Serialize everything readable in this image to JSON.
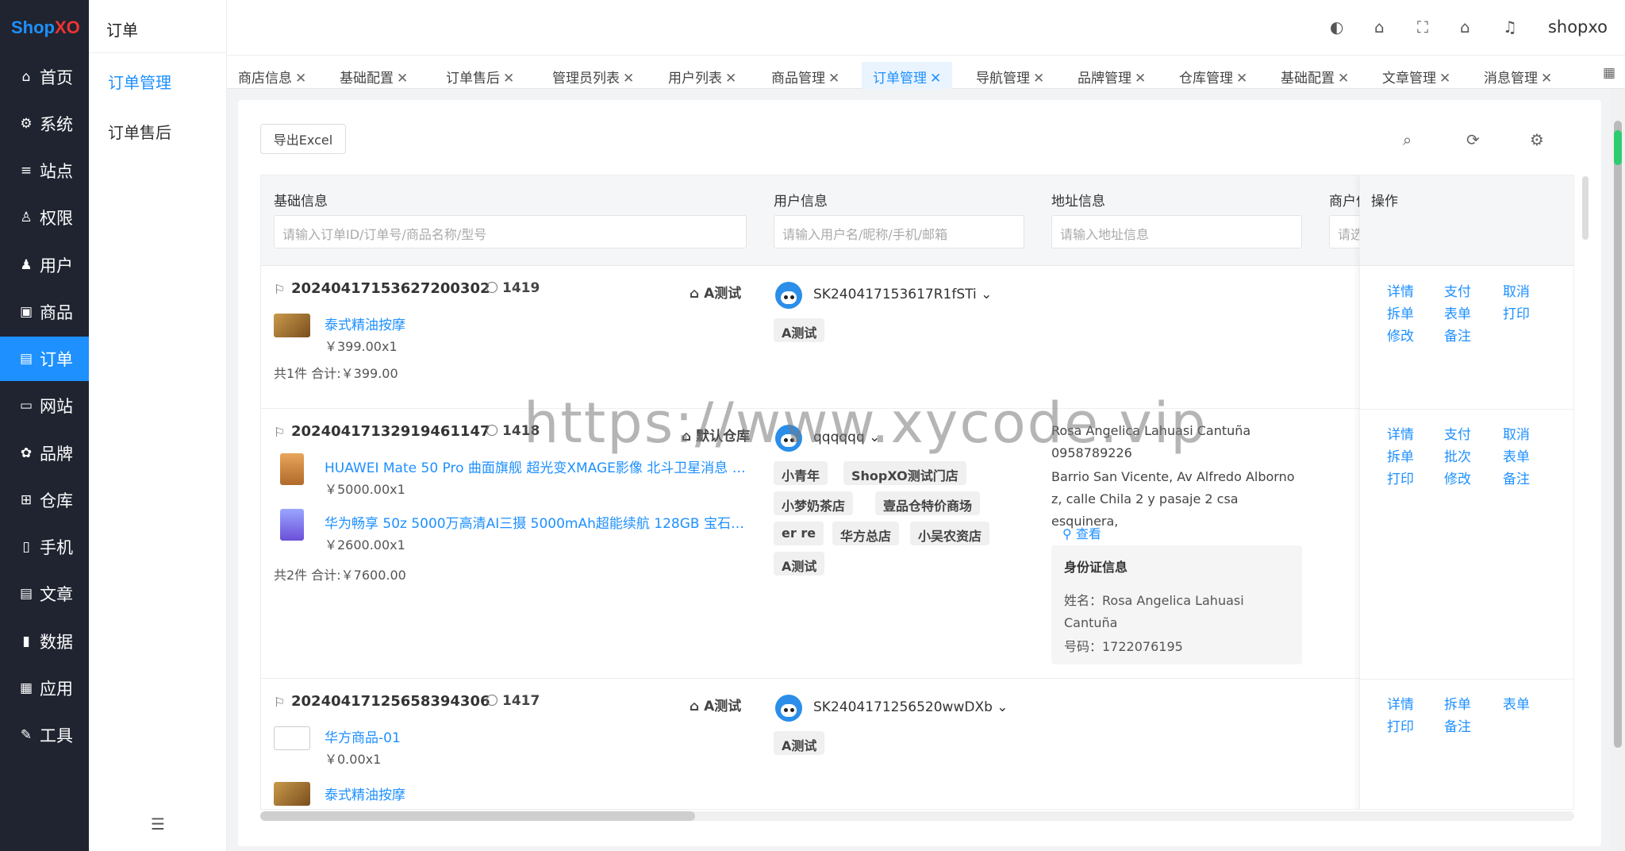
{
  "brand": {
    "shop": "Shop",
    "xo": "XO"
  },
  "nav": [
    {
      "label": "首页",
      "icon": "home-icon"
    },
    {
      "label": "系统",
      "icon": "gear-icon"
    },
    {
      "label": "站点",
      "icon": "sliders-icon"
    },
    {
      "label": "权限",
      "icon": "user-lock-icon"
    },
    {
      "label": "用户",
      "icon": "user-icon"
    },
    {
      "label": "商品",
      "icon": "box-icon"
    },
    {
      "label": "订单",
      "icon": "order-icon"
    },
    {
      "label": "网站",
      "icon": "monitor-icon"
    },
    {
      "label": "品牌",
      "icon": "brand-icon"
    },
    {
      "label": "仓库",
      "icon": "warehouse-icon"
    },
    {
      "label": "手机",
      "icon": "phone-icon"
    },
    {
      "label": "文章",
      "icon": "article-icon"
    },
    {
      "label": "数据",
      "icon": "chart-icon"
    },
    {
      "label": "应用",
      "icon": "apps-icon"
    },
    {
      "label": "工具",
      "icon": "wrench-icon"
    }
  ],
  "subnav": {
    "title": "订单",
    "items": [
      "订单管理",
      "订单售后"
    ]
  },
  "header": {
    "user": "shopxo"
  },
  "tabs": [
    "商店信息",
    "基础配置",
    "订单售后",
    "管理员列表",
    "用户列表",
    "商品管理",
    "订单管理",
    "导航管理",
    "品牌管理",
    "仓库管理",
    "基础配置",
    "文章管理",
    "消息管理"
  ],
  "toolbar": {
    "export": "导出Excel"
  },
  "table": {
    "headers": {
      "basic": "基础信息",
      "user": "用户信息",
      "address": "地址信息",
      "merchant": "商户信",
      "ops": "操作"
    },
    "filters": {
      "basic": "请输入订单ID/订单号/商品名称/型号",
      "user": "请输入用户名/昵称/手机/邮箱",
      "address": "请输入地址信息",
      "merchant": "请选"
    },
    "rows": [
      {
        "order_no": "20240417153627200302",
        "id": "1419",
        "store": "A测试",
        "goods": [
          {
            "name": "泰式精油按摩",
            "price": "￥399.00x1"
          }
        ],
        "total": "共1件 合计:￥399.00",
        "user": "SK240417153617R1fSTi",
        "tags": [
          "A测试"
        ],
        "ops": [
          "详情",
          "支付",
          "取消",
          "拆单",
          "表单",
          "打印",
          "修改",
          "备注"
        ]
      },
      {
        "order_no": "20240417132919461147",
        "id": "1418",
        "store": "默认仓库",
        "goods": [
          {
            "name": "HUAWEI Mate 50 Pro 曲面旗舰 超光变XMAGE影像 北斗卫星消息 2...",
            "price": "￥5000.00x1"
          },
          {
            "name": "华为畅享 50z 5000万高清AI三摄 5000mAh超能续航 128GB 宝石蓝 ...",
            "price": "￥2600.00x1"
          }
        ],
        "total": "共2件 合计:￥7600.00",
        "user": "qqqqqq",
        "tags": [
          "小青年",
          "ShopXO测试门店",
          "小梦奶茶店",
          "壹品仓特价商场",
          "er re",
          "华方总店",
          "小吴农资店",
          "A测试"
        ],
        "address": {
          "name_phone": "Rosa Angelica Lahuasi Cantuña 0958789226",
          "detail": "Barrio San Vicente, Av Alfredo Alborno z, calle Chila 2 y pasaje 2 csa esquinera,",
          "view": "查看",
          "id_title": "身份证信息",
          "id_name": "姓名：Rosa Angelica Lahuasi Cantuña",
          "id_no": "号码：1722076195"
        },
        "ops": [
          "详情",
          "支付",
          "取消",
          "拆单",
          "批次",
          "表单",
          "打印",
          "修改",
          "备注"
        ]
      },
      {
        "order_no": "20240417125658394306",
        "id": "1417",
        "store": "A测试",
        "goods": [
          {
            "name": "华方商品-01",
            "price": "￥0.00x1"
          },
          {
            "name": "泰式精油按摩",
            "price": ""
          }
        ],
        "user": "SK2404171256520wwDXb",
        "tags": [
          "A测试"
        ],
        "ops": [
          "详情",
          "拆单",
          "表单",
          "打印",
          "备注"
        ]
      }
    ]
  },
  "watermark": "https://www.xycode.vip"
}
